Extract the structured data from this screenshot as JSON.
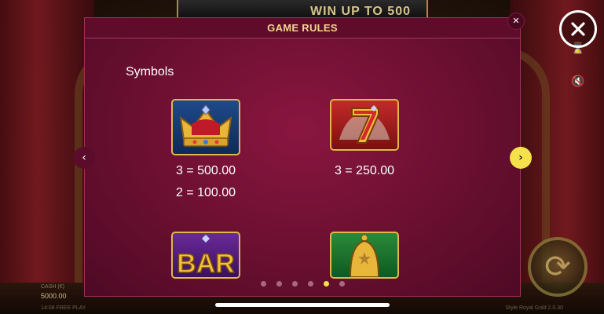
{
  "background": {
    "banner_text": "WIN UP TO 500",
    "cash_label": "CASH (€)",
    "cash_value": "5000.00",
    "free_play": "14:08 FREE PLAY",
    "version": "Style Royal Gold 2.0.30"
  },
  "modal": {
    "title": "GAME RULES",
    "close_glyph": "✕",
    "section_title": "Symbols",
    "symbols": [
      {
        "icon": "crown-symbol",
        "pays": [
          "3 = 500.00",
          "2 = 100.00"
        ]
      },
      {
        "icon": "seven-symbol",
        "pays": [
          "3 = 250.00"
        ]
      },
      {
        "icon": "bar-symbol",
        "pays": []
      },
      {
        "icon": "bell-symbol",
        "pays": []
      }
    ],
    "pager": {
      "count": 6,
      "active_index": 4
    }
  },
  "colors": {
    "modal_bg": "#6a0f30",
    "title_gold": "#f3d58b",
    "accent_yellow": "#f5e24a"
  }
}
